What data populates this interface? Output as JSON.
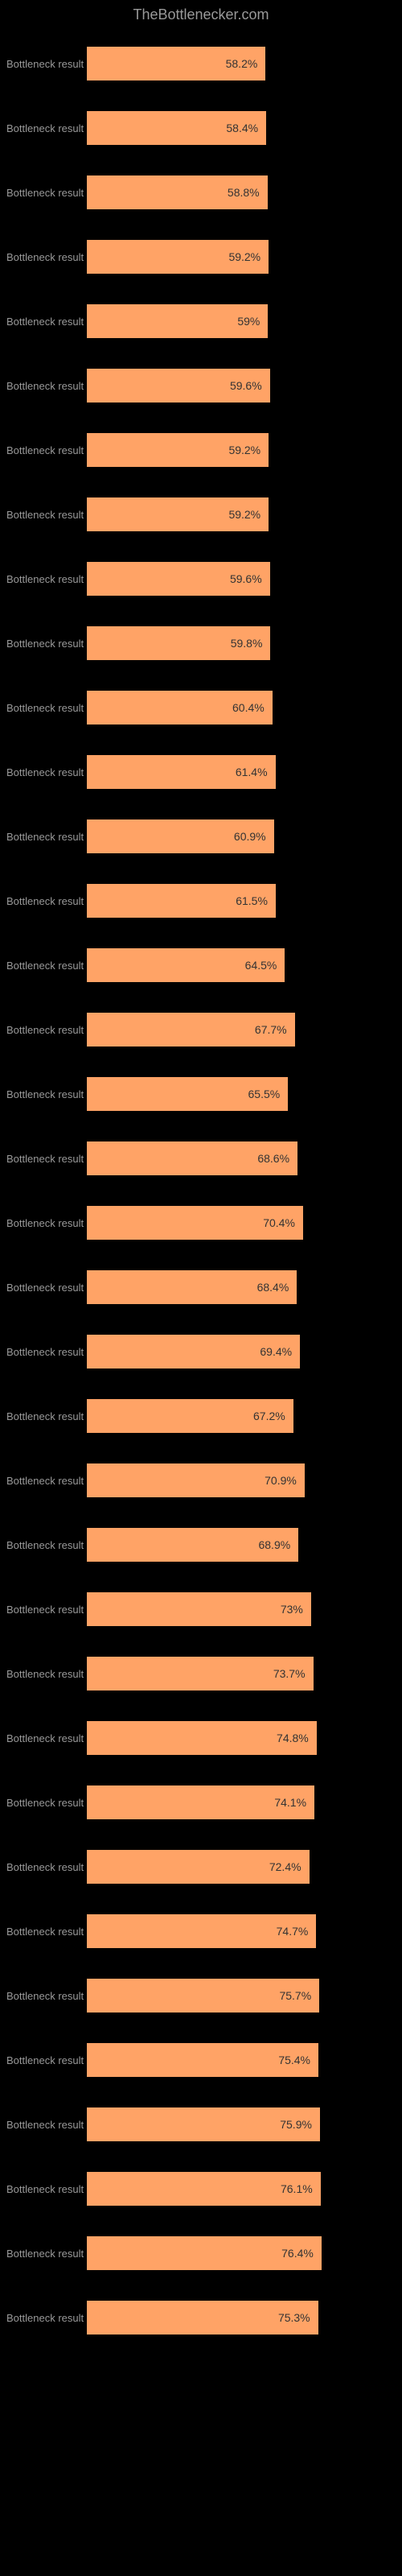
{
  "chart_data": {
    "type": "bar",
    "title": "TheBottlenecker.com",
    "xlabel": "",
    "ylabel": "Bottleneck result",
    "xlim": [
      0,
      100
    ],
    "series_label": "Bottleneck result",
    "bars": [
      {
        "upper": "",
        "value": 58.2,
        "display": "58.2%"
      },
      {
        "upper": "",
        "value": 58.4,
        "display": "58.4%"
      },
      {
        "upper": "",
        "value": 58.8,
        "display": "58.8%"
      },
      {
        "upper": "",
        "value": 59.2,
        "display": "59.2%"
      },
      {
        "upper": "",
        "value": 59.0,
        "display": "59%"
      },
      {
        "upper": "",
        "value": 59.6,
        "display": "59.6%"
      },
      {
        "upper": "",
        "value": 59.2,
        "display": "59.2%"
      },
      {
        "upper": "",
        "value": 59.2,
        "display": "59.2%"
      },
      {
        "upper": "",
        "value": 59.6,
        "display": "59.6%"
      },
      {
        "upper": "",
        "value": 59.8,
        "display": "59.8%"
      },
      {
        "upper": "",
        "value": 60.4,
        "display": "60.4%"
      },
      {
        "upper": "",
        "value": 61.4,
        "display": "61.4%"
      },
      {
        "upper": "",
        "value": 60.9,
        "display": "60.9%"
      },
      {
        "upper": "",
        "value": 61.5,
        "display": "61.5%"
      },
      {
        "upper": "",
        "value": 64.5,
        "display": "64.5%"
      },
      {
        "upper": "",
        "value": 67.7,
        "display": "67.7%"
      },
      {
        "upper": "",
        "value": 65.5,
        "display": "65.5%"
      },
      {
        "upper": "",
        "value": 68.6,
        "display": "68.6%"
      },
      {
        "upper": "",
        "value": 70.4,
        "display": "70.4%"
      },
      {
        "upper": "",
        "value": 68.4,
        "display": "68.4%"
      },
      {
        "upper": "",
        "value": 69.4,
        "display": "69.4%"
      },
      {
        "upper": "",
        "value": 67.2,
        "display": "67.2%"
      },
      {
        "upper": "",
        "value": 70.9,
        "display": "70.9%"
      },
      {
        "upper": "",
        "value": 68.9,
        "display": "68.9%"
      },
      {
        "upper": "",
        "value": 73.0,
        "display": "73%"
      },
      {
        "upper": "",
        "value": 73.7,
        "display": "73.7%"
      },
      {
        "upper": "",
        "value": 74.8,
        "display": "74.8%"
      },
      {
        "upper": "",
        "value": 74.1,
        "display": "74.1%"
      },
      {
        "upper": "",
        "value": 72.4,
        "display": "72.4%"
      },
      {
        "upper": "",
        "value": 74.7,
        "display": "74.7%"
      },
      {
        "upper": "",
        "value": 75.7,
        "display": "75.7%"
      },
      {
        "upper": "",
        "value": 75.4,
        "display": "75.4%"
      },
      {
        "upper": "",
        "value": 75.9,
        "display": "75.9%"
      },
      {
        "upper": "",
        "value": 76.1,
        "display": "76.1%"
      },
      {
        "upper": "",
        "value": 76.4,
        "display": "76.4%"
      },
      {
        "upper": "",
        "value": 75.3,
        "display": "75.3%"
      }
    ]
  }
}
